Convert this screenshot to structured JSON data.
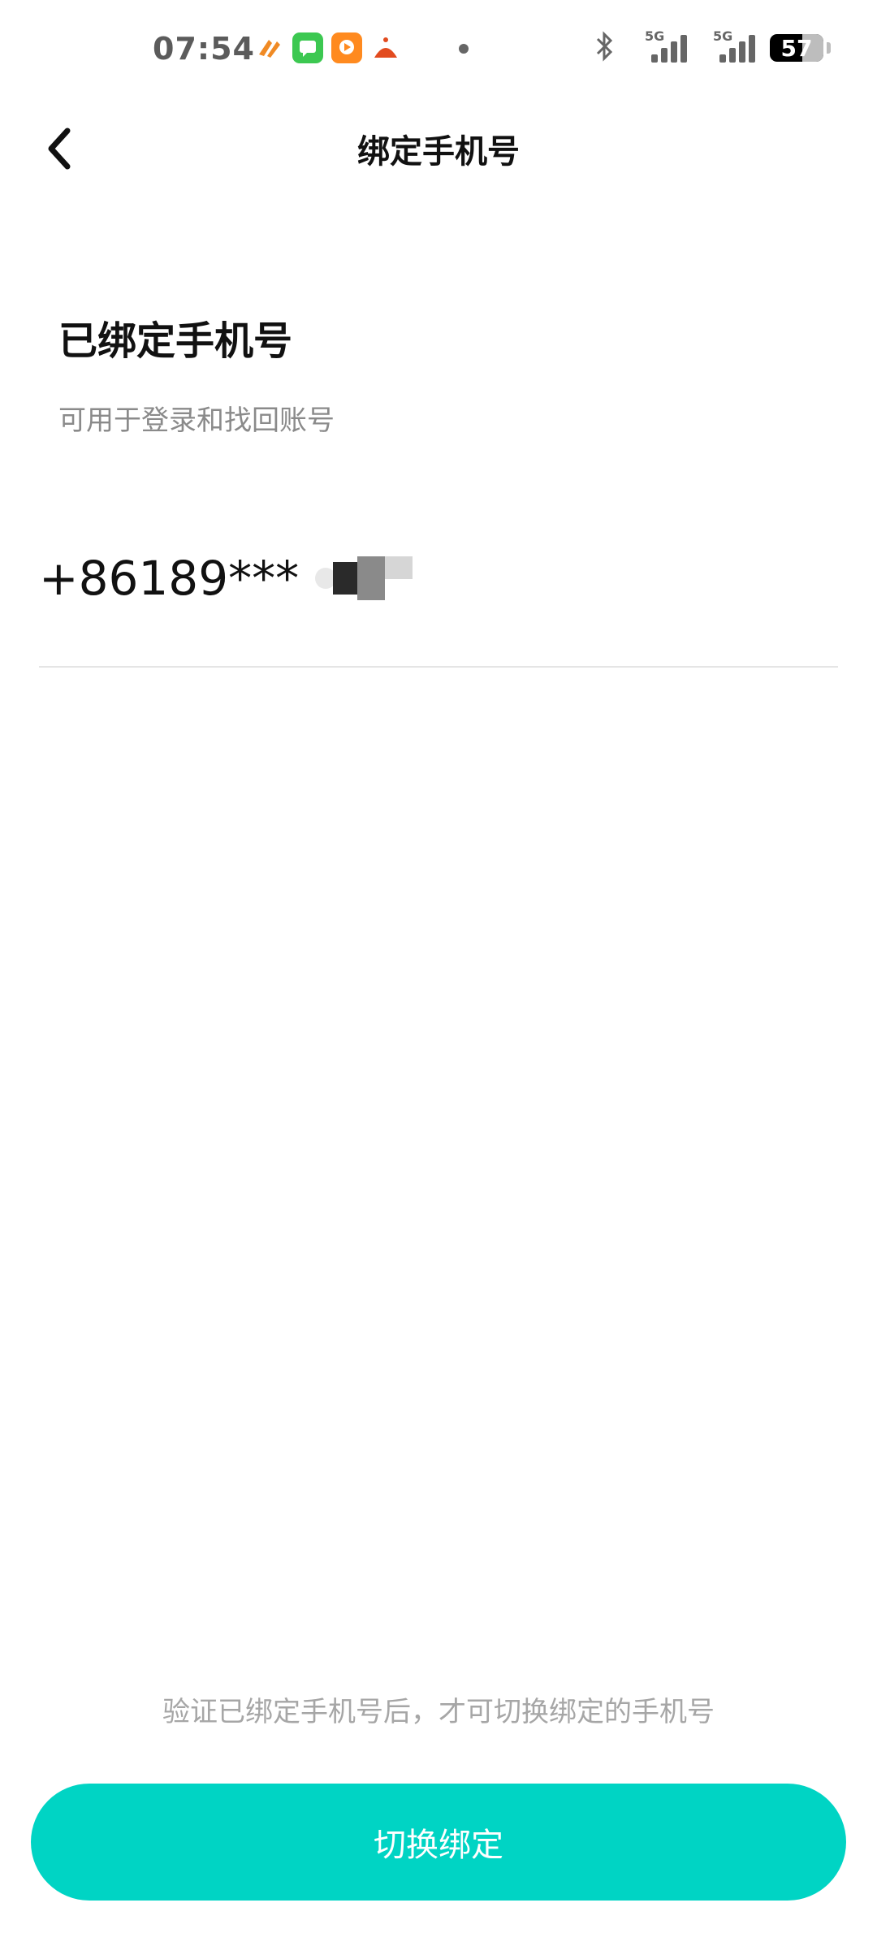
{
  "status_bar": {
    "time": "07:54",
    "network_1": "5G",
    "network_2": "5G",
    "battery": "57"
  },
  "nav": {
    "title": "绑定手机号"
  },
  "content": {
    "section_title": "已绑定手机号",
    "section_subtitle": "可用于登录和找回账号",
    "phone_number": "+86189***"
  },
  "footer": {
    "hint": "验证已绑定手机号后，才可切换绑定的手机号",
    "button_label": "切换绑定"
  },
  "colors": {
    "accent": "#00d4c4"
  }
}
